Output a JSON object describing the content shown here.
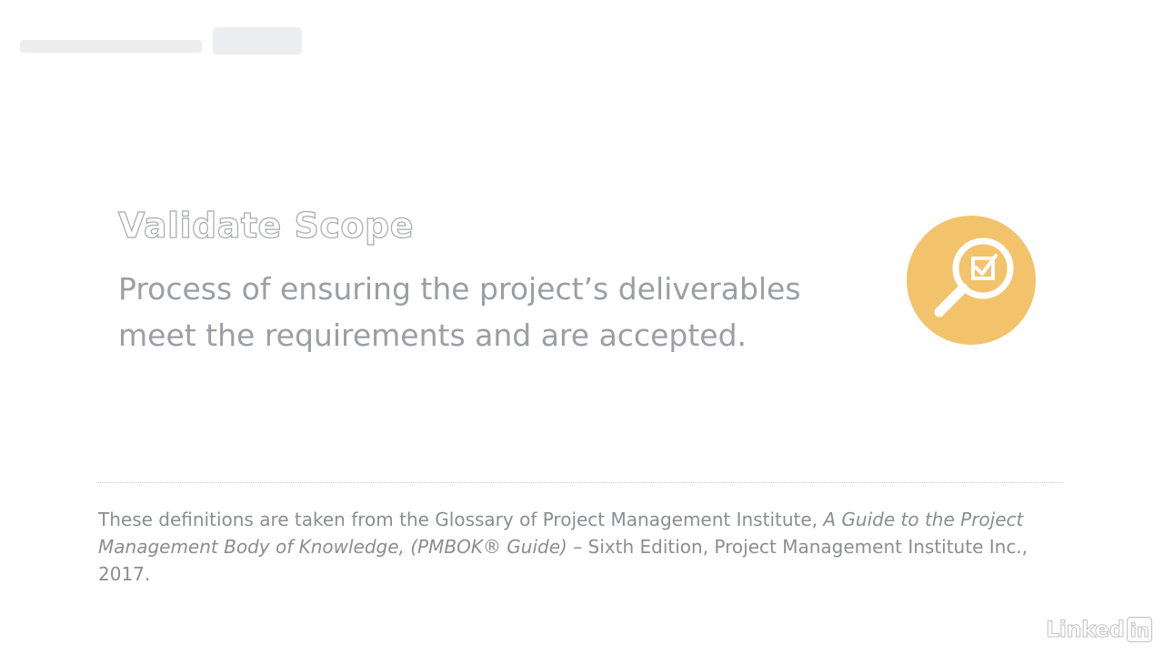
{
  "slide": {
    "term": "Validate Scope",
    "definition": "Process of ensuring the project’s deliverables meet the requirements and are accepted.",
    "icon": "magnifier-checkbox-icon",
    "accent_color": "#f2c36b",
    "citation": {
      "part1": "These definitions are taken from the Glossary of Project Management Institute, ",
      "title_italic": "A Guide to the Project Management Body of Knowledge, (PMBOK® Guide)",
      "part2": " – Sixth Edition, Project Management Institute Inc., 2017."
    }
  },
  "branding": {
    "logo_word": "Linked",
    "logo_in": "in"
  }
}
